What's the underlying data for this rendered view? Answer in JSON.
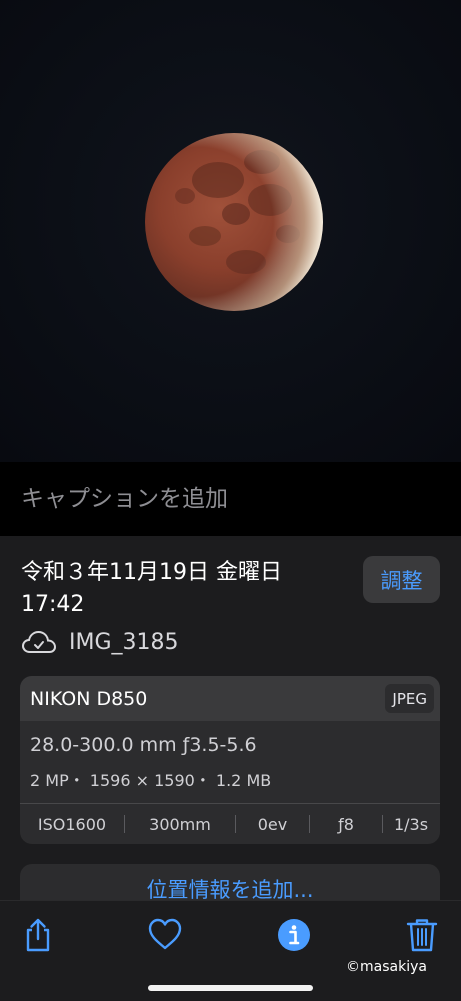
{
  "caption": {
    "placeholder": "キャプションを追加"
  },
  "info": {
    "date": "令和３年11月19日 金曜日",
    "time": "17:42",
    "adjust_label": "調整",
    "filename": "IMG_3185"
  },
  "exif": {
    "camera": "NIKON D850",
    "format": "JPEG",
    "lens": "28.0-300.0 mm ƒ3.5-5.6",
    "specs": "2 MP・ 1596 × 1590・ 1.2 MB",
    "iso": "ISO1600",
    "focal_length": "300mm",
    "exposure_comp": "0ev",
    "aperture": "ƒ8",
    "shutter": "1/3s"
  },
  "location_button": "位置情報を追加...",
  "toolbar": {
    "share_icon": "share-icon",
    "favorite_icon": "heart-icon",
    "info_icon": "info-icon",
    "delete_icon": "trash-icon"
  },
  "watermark": "©masakiya",
  "colors": {
    "accent": "#4a9cff",
    "sheet": "#1c1c1e",
    "card": "#2c2c2e"
  }
}
